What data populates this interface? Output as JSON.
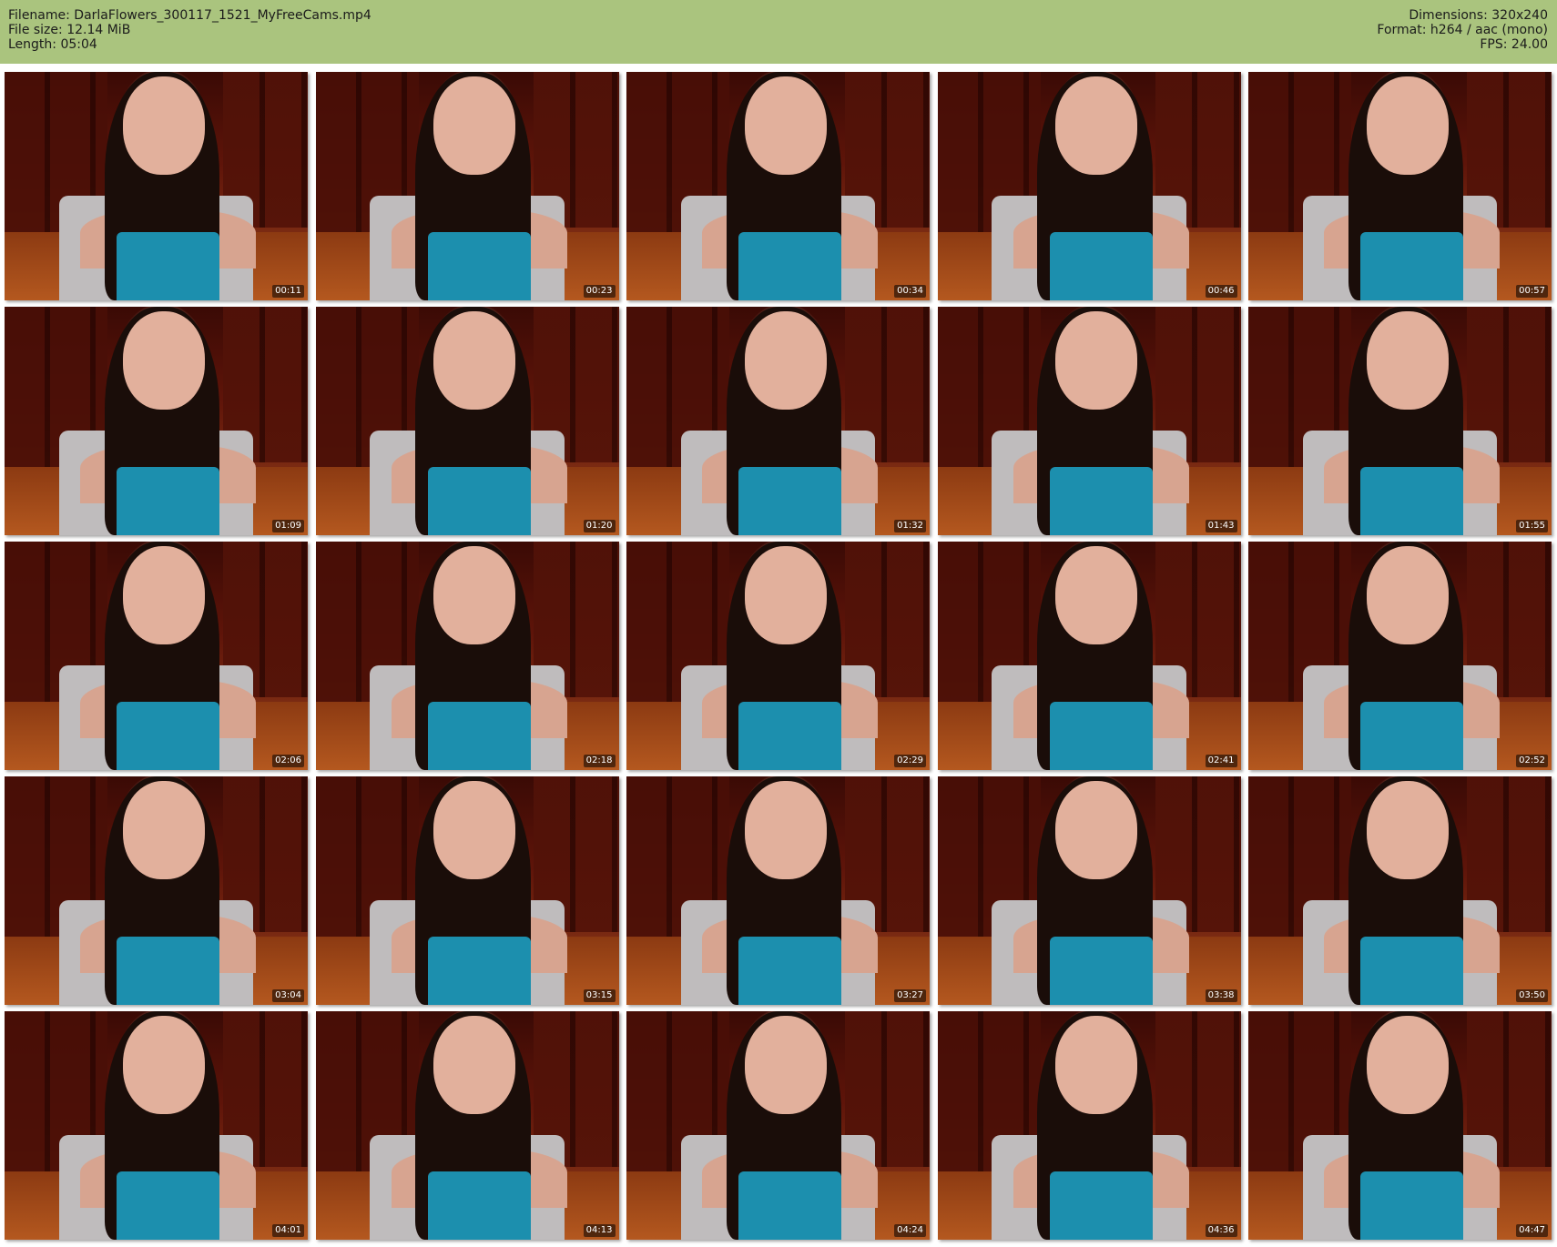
{
  "header": {
    "filename": "Filename: DarlaFlowers_300117_1521_MyFreeCams.mp4",
    "file_size": "File size: 12.14 MiB",
    "length": "Length: 05:04",
    "dimensions": "Dimensions: 320x240",
    "format": "Format: h264 / aac (mono)",
    "fps": "FPS: 24.00"
  },
  "colors": {
    "header_background": "#aac47e",
    "page_background": "#ffffff"
  },
  "thumbnails": [
    {
      "time": "00:11"
    },
    {
      "time": "00:23"
    },
    {
      "time": "00:34"
    },
    {
      "time": "00:46"
    },
    {
      "time": "00:57"
    },
    {
      "time": "01:09"
    },
    {
      "time": "01:20"
    },
    {
      "time": "01:32"
    },
    {
      "time": "01:43"
    },
    {
      "time": "01:55"
    },
    {
      "time": "02:06"
    },
    {
      "time": "02:18"
    },
    {
      "time": "02:29"
    },
    {
      "time": "02:41"
    },
    {
      "time": "02:52"
    },
    {
      "time": "03:04"
    },
    {
      "time": "03:15"
    },
    {
      "time": "03:27"
    },
    {
      "time": "03:38"
    },
    {
      "time": "03:50"
    },
    {
      "time": "04:01"
    },
    {
      "time": "04:13"
    },
    {
      "time": "04:24"
    },
    {
      "time": "04:36"
    },
    {
      "time": "04:47"
    }
  ]
}
